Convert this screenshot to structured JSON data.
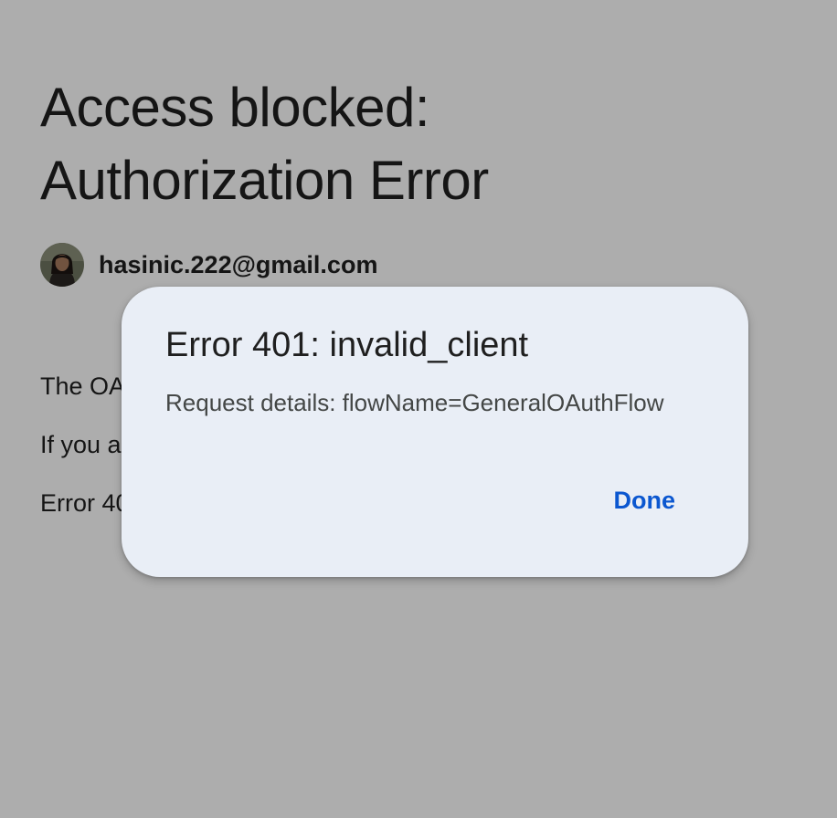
{
  "page": {
    "title": "Access blocked: Authorization Error",
    "account": {
      "email": "hasinic.222@gmail.com",
      "avatar_icon": "user-avatar"
    },
    "body_lines": [
      "The OA",
      "If you a",
      "Error 40"
    ]
  },
  "dialog": {
    "title": "Error 401: invalid_client",
    "details": "Request details: flowName=GeneralOAuthFlow",
    "done_label": "Done"
  },
  "colors": {
    "page_background": "#ffffff",
    "scrim": "rgba(0,0,0,0.32)",
    "dialog_background": "#e9eef6",
    "text_primary": "#1f1f1f",
    "text_secondary": "#444746",
    "accent": "#0b57d0"
  }
}
